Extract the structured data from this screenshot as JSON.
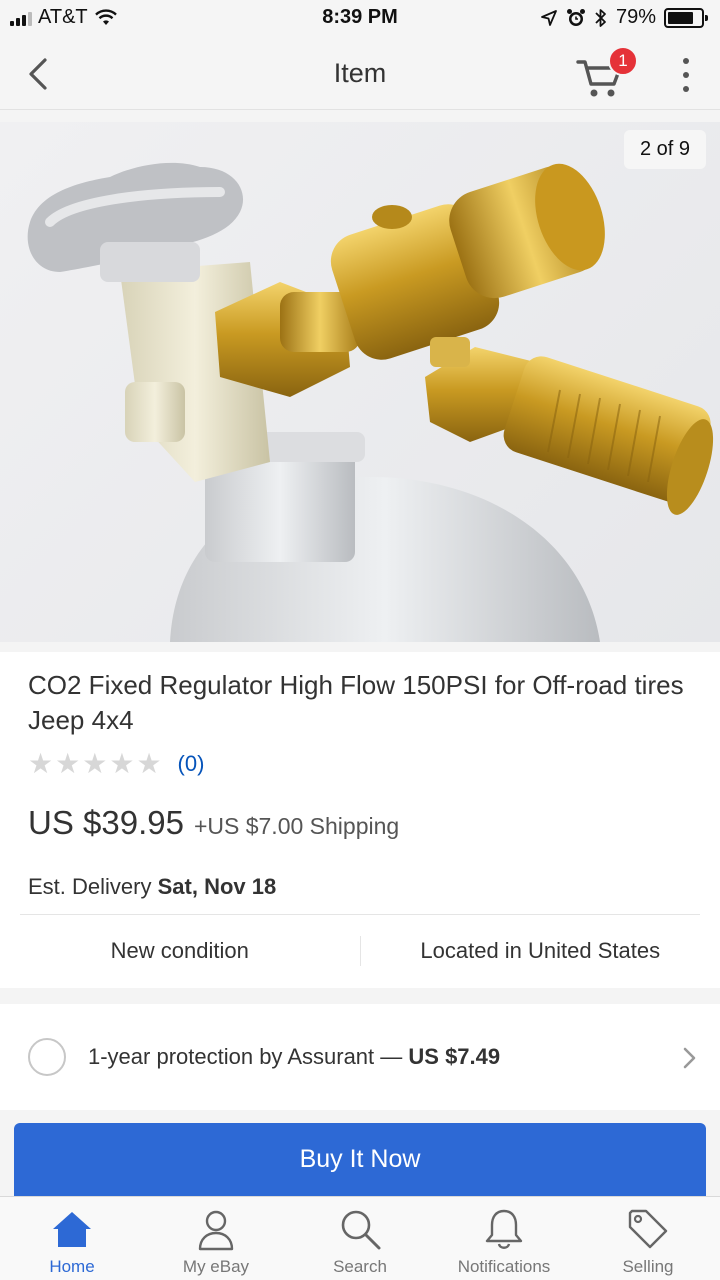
{
  "status_bar": {
    "carrier": "AT&T",
    "time": "8:39 PM",
    "battery_percent": "79%",
    "battery_level": 0.79,
    "icons": [
      "signal-icon",
      "wifi-icon",
      "location-icon",
      "alarm-icon",
      "bluetooth-icon",
      "battery-icon"
    ]
  },
  "header": {
    "title": "Item",
    "cart_count": "1",
    "icons": [
      "back-chevron-icon",
      "cart-icon",
      "more-vertical-icon"
    ]
  },
  "gallery": {
    "counter": "2 of 9"
  },
  "item": {
    "title": "CO2 Fixed Regulator High Flow 150PSI for Off-road tires Jeep 4x4",
    "stars_filled": 0,
    "stars_total": 5,
    "review_count": "(0)",
    "price": "US $39.95",
    "shipping": "+US $7.00 Shipping",
    "delivery_label": "Est. Delivery",
    "delivery_date": "Sat, Nov 18",
    "condition": "New condition",
    "location": "Located in United States"
  },
  "protection": {
    "label": "1-year protection by Assurant —",
    "price": "US $7.49"
  },
  "buy_button": {
    "label": "Buy It Now"
  },
  "tabs": [
    {
      "label": "Home",
      "icon": "home-icon",
      "active": true
    },
    {
      "label": "My eBay",
      "icon": "person-icon",
      "active": false
    },
    {
      "label": "Search",
      "icon": "search-icon",
      "active": false
    },
    {
      "label": "Notifications",
      "icon": "bell-icon",
      "active": false
    },
    {
      "label": "Selling",
      "icon": "tag-icon",
      "active": false
    }
  ],
  "colors": {
    "accent_blue": "#2d69d5",
    "link_blue": "#0654ba",
    "badge_red": "#e53238"
  }
}
